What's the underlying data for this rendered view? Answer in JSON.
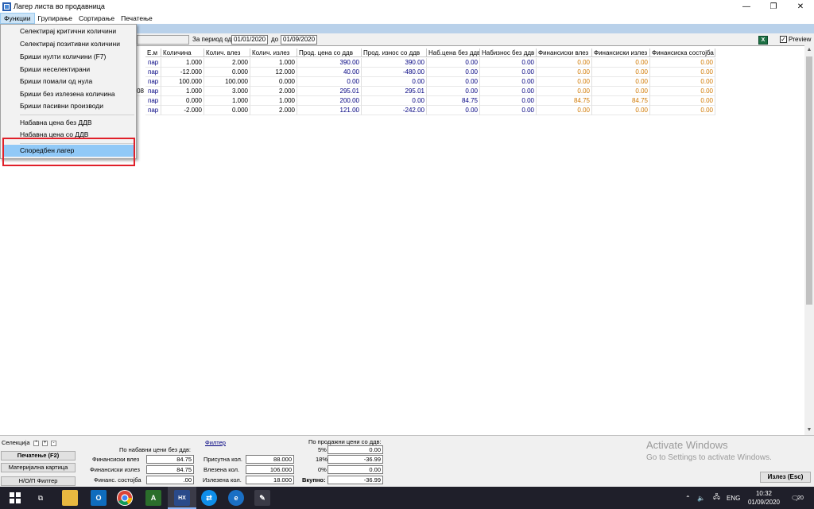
{
  "window": {
    "title": "Лагер листа во продавница",
    "controls": [
      "—",
      "❐",
      "✕"
    ]
  },
  "menubar": [
    "Функции",
    "Групирање",
    "Сортирање",
    "Печатење"
  ],
  "toolbar": {
    "period_label": "За период од",
    "date_from": "01/01/2020",
    "to_label": "до",
    "date_to": "01/09/2020",
    "excel_icon": "excel-icon",
    "preview_label": "Preview",
    "preview_checked": true
  },
  "dropdown": {
    "items": [
      "Селектирај критични количини",
      "Селектирај позитивни количини",
      "Бриши нулти количини (F7)",
      "Бриши неселектирани",
      "Бриши помали од нула",
      "Бриши без излезена количина",
      "Бриши пасивни производи",
      "Набавна цена без ДДВ",
      "Набавна цена со ДДВ",
      "Споредбен лагер"
    ],
    "highlighted": "Споредбен лагер"
  },
  "table": {
    "columns": [
      "Е.м",
      "Количина",
      "Колич. влез",
      "Колич. излез",
      "Прод. цена со ддв",
      "Прод. износ со ддв",
      "Наб.цена без ддв",
      "Набизнос без ддв",
      "Финансиски влез",
      "Финансиски излез",
      "Финансиска состојба"
    ],
    "partial_id": "08",
    "rows": [
      [
        "пар",
        "1.000",
        "2.000",
        "1.000",
        "390.00",
        "390.00",
        "0.00",
        "0.00",
        "0.00",
        "0.00",
        "0.00"
      ],
      [
        "пар",
        "-12.000",
        "0.000",
        "12.000",
        "40.00",
        "-480.00",
        "0.00",
        "0.00",
        "0.00",
        "0.00",
        "0.00"
      ],
      [
        "пар",
        "100.000",
        "100.000",
        "0.000",
        "0.00",
        "0.00",
        "0.00",
        "0.00",
        "0.00",
        "0.00",
        "0.00"
      ],
      [
        "пар",
        "1.000",
        "3.000",
        "2.000",
        "295.01",
        "295.01",
        "0.00",
        "0.00",
        "0.00",
        "0.00",
        "0.00"
      ],
      [
        "пар",
        "0.000",
        "1.000",
        "1.000",
        "200.00",
        "0.00",
        "84.75",
        "0.00",
        "84.75",
        "84.75",
        "0.00"
      ],
      [
        "пар",
        "-2.000",
        "0.000",
        "2.000",
        "121.00",
        "-242.00",
        "0.00",
        "0.00",
        "0.00",
        "0.00",
        "0.00"
      ]
    ]
  },
  "bottom": {
    "selection_label": "Селекција",
    "sel_buttons": [
      "*",
      "+",
      "-"
    ],
    "print_button": "Печатење (F2)",
    "material_card_button": "Материјална картица",
    "filter_button": "Н/О/П Филтер",
    "purchase_header": "По набавни цени без ддв:",
    "fin_in_label": "Финансиски влез",
    "fin_in_value": "84.75",
    "fin_out_label": "Финансиски излез",
    "fin_out_value": "84.75",
    "fin_state_label": "Финанс. состојба",
    "fin_state_value": ".00",
    "filter_link": "Филтер",
    "present_qty_label": "Присутна кол.",
    "present_qty_value": "88.000",
    "in_qty_label": "Влезена кол.",
    "in_qty_value": "106.000",
    "out_qty_label": "Излезена кол.",
    "out_qty_value": "18.000",
    "sales_header": "По продажни цени со ддв:",
    "vat5_label": "5%",
    "vat5_value": "0.00",
    "vat18_label": "18%",
    "vat18_value": "-36.99",
    "vat0_label": "0%",
    "vat0_value": "0.00",
    "total_label": "Вкупно:",
    "total_value": "-36.99",
    "activate_title": "Activate Windows",
    "activate_sub": "Go to Settings to activate Windows.",
    "exit_button": "Излез (Esc)"
  },
  "taskbar": {
    "lang": "ENG",
    "time": "10:32",
    "date": "01/09/2020",
    "notifications": "20"
  }
}
